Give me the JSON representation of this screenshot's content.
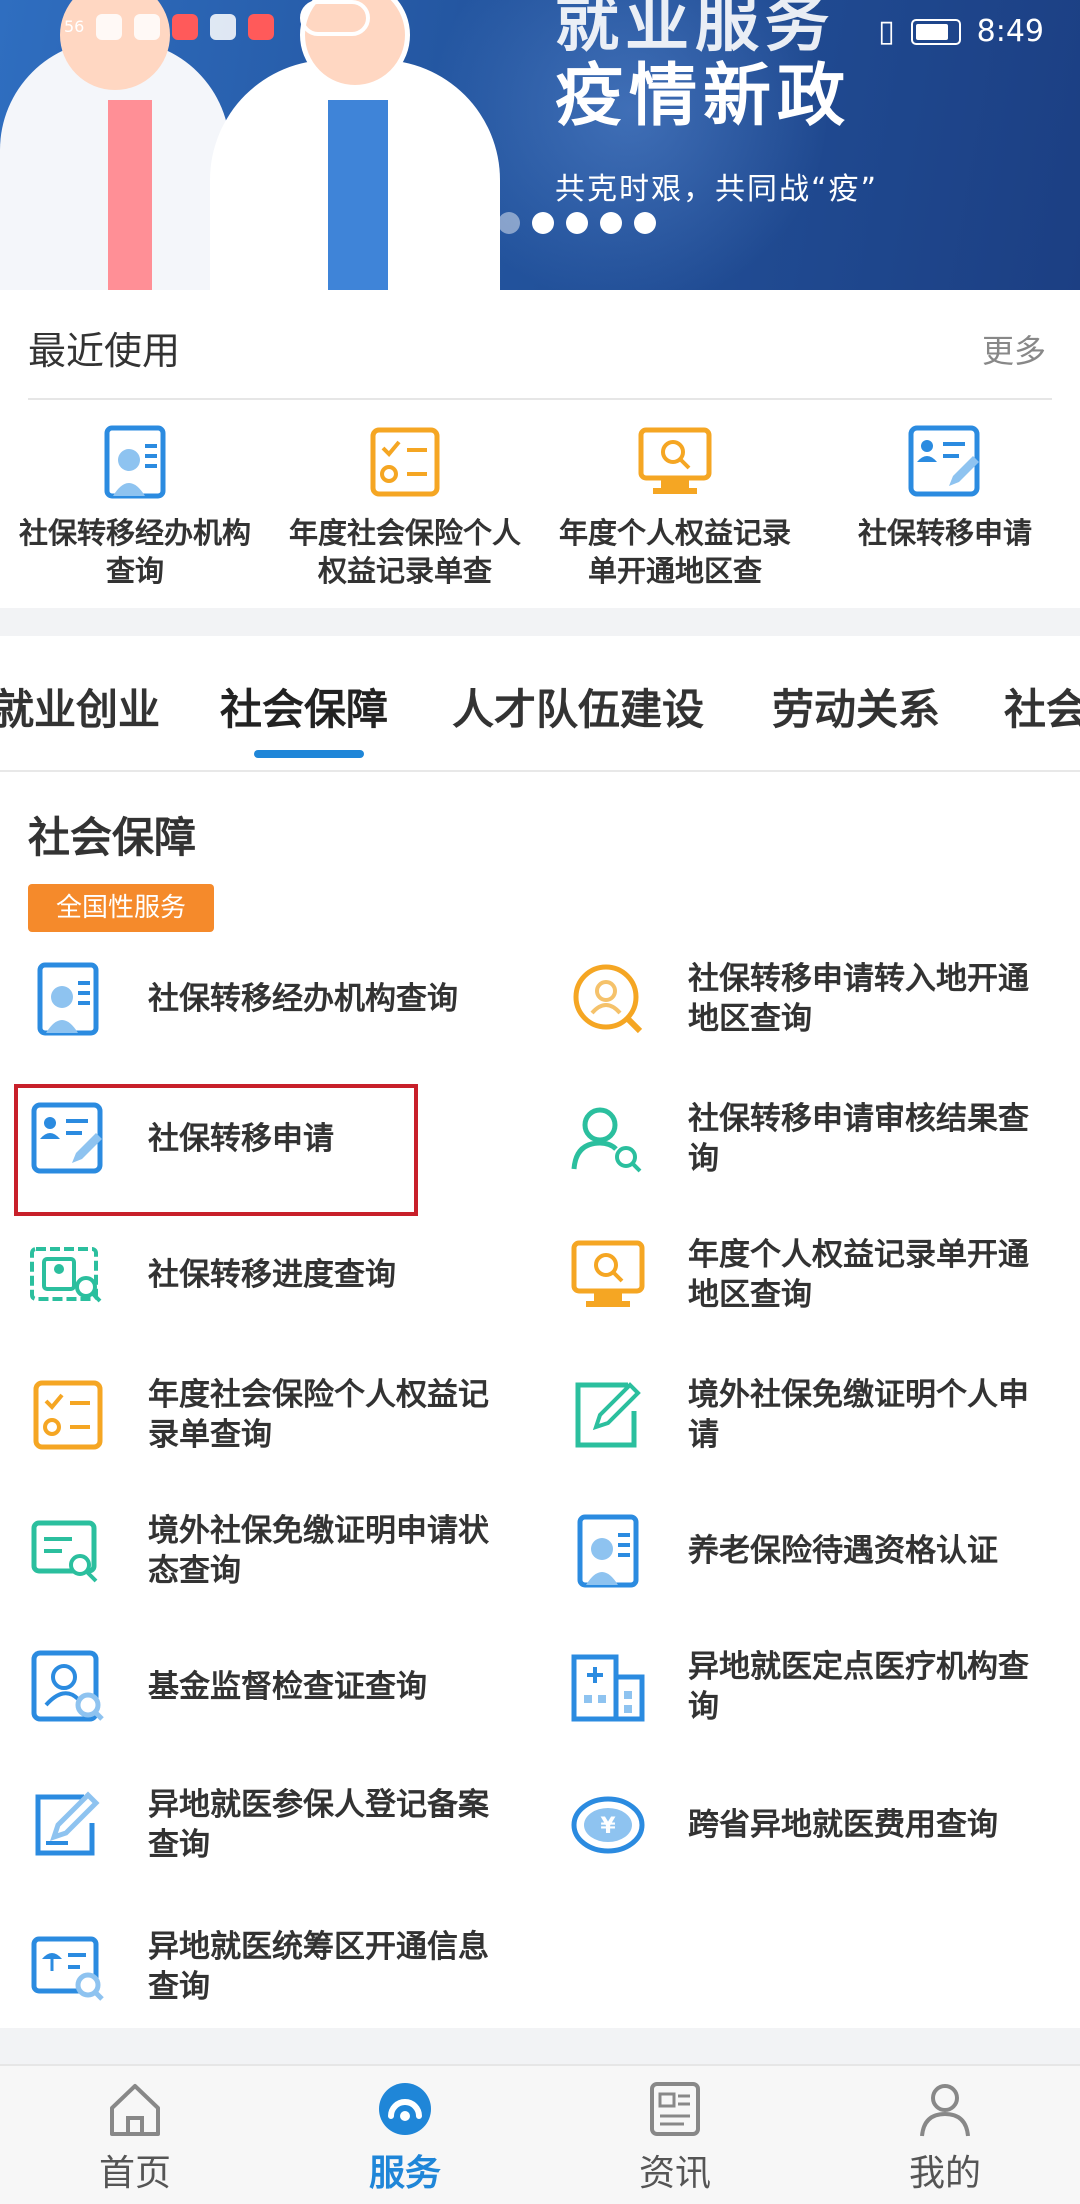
{
  "banner": {
    "title_top": "就业服务",
    "title": "疫情新政",
    "subtitle": "共克时艰，共同战“疫”"
  },
  "status_bar": {
    "time": "8:49",
    "signal": "56"
  },
  "recent": {
    "title": "最近使用",
    "more": "更多",
    "items": [
      {
        "label": "社保转移经办机构查询",
        "icon": "id-card-icon"
      },
      {
        "label": "年度社会保险个人权益记录单查",
        "icon": "checklist-icon"
      },
      {
        "label": "年度个人权益记录单开通地区查",
        "icon": "monitor-search-icon"
      },
      {
        "label": "社保转移申请",
        "icon": "edit-card-icon"
      }
    ]
  },
  "tabs": [
    {
      "label": "就业创业"
    },
    {
      "label": "社会保障",
      "active": true
    },
    {
      "label": "人才队伍建设"
    },
    {
      "label": "劳动关系"
    },
    {
      "label": "社会"
    }
  ],
  "section": {
    "title": "社会保障",
    "tag": "全国性服务",
    "items": [
      {
        "label": "社保转移经办机构查询",
        "icon": "id-card-icon"
      },
      {
        "label": "社保转移申请转入地开通地区查询",
        "icon": "person-search-icon"
      },
      {
        "label": "社保转移申请",
        "icon": "edit-card-icon"
      },
      {
        "label": "社保转移申请审核结果查询",
        "icon": "user-search-icon"
      },
      {
        "label": "社保转移进度查询",
        "icon": "progress-search-icon"
      },
      {
        "label": "年度个人权益记录单开通地区查询",
        "icon": "monitor-search-icon"
      },
      {
        "label": "年度社会保险个人权益记录单查询",
        "icon": "checklist-icon"
      },
      {
        "label": "境外社保免缴证明个人申请",
        "icon": "pencil-doc-icon"
      },
      {
        "label": "境外社保免缴证明申请状态查询",
        "icon": "doc-search-icon"
      },
      {
        "label": "养老保险待遇资格认证",
        "icon": "id-card-icon"
      },
      {
        "label": "基金监督检查证查询",
        "icon": "badge-search-icon"
      },
      {
        "label": "异地就医定点医疗机构查询",
        "icon": "hospital-icon"
      },
      {
        "label": "异地就医参保人登记备案查询",
        "icon": "pencil-doc-icon"
      },
      {
        "label": "跨省异地就医费用查询",
        "icon": "yen-coin-icon"
      },
      {
        "label": "异地就医统筹区开通信息查询",
        "icon": "umbrella-search-icon"
      }
    ]
  },
  "bottom_nav": [
    {
      "label": "首页",
      "icon": "home-icon"
    },
    {
      "label": "服务",
      "icon": "service-icon",
      "active": true
    },
    {
      "label": "资讯",
      "icon": "news-icon"
    },
    {
      "label": "我的",
      "icon": "user-icon"
    }
  ],
  "colors": {
    "accent": "#1f86d8",
    "tag": "#f58a2b",
    "highlight": "#c8202a",
    "icon_blue": "#2b8be0",
    "icon_orange": "#f5a623",
    "icon_teal": "#2bbf9e"
  }
}
